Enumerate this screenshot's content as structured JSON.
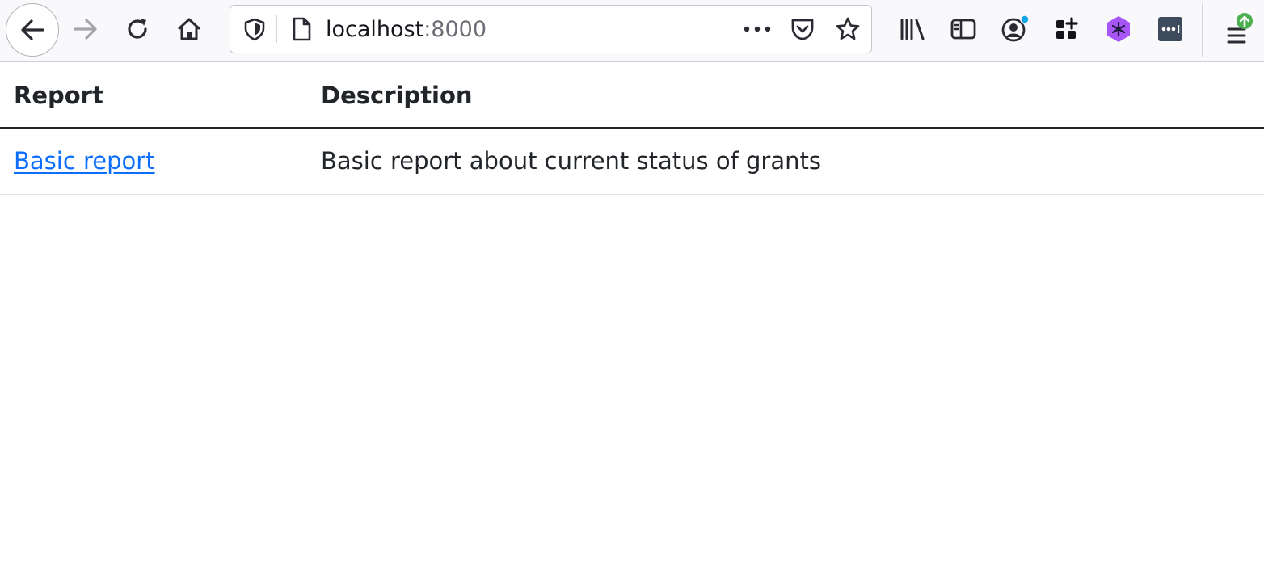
{
  "browser": {
    "url_host": "localhost",
    "url_port": ":8000",
    "toolbar_icons": [
      "back-icon",
      "forward-icon",
      "reload-icon",
      "home-icon",
      "shield-icon",
      "page-icon",
      "more-icon",
      "pocket-icon",
      "star-icon",
      "library-icon",
      "sidebar-icon",
      "account-icon",
      "extension-grid-icon",
      "extension-purple-icon",
      "extension-dark-icon",
      "menu-icon"
    ],
    "colors": {
      "notification_dot": "#0ea5e9",
      "update_badge": "#4caf50",
      "purple_extension": "#a855f7",
      "link": "#0d6efd"
    }
  },
  "table": {
    "headers": {
      "report": "Report",
      "description": "Description"
    },
    "rows": [
      {
        "report": "Basic report",
        "description": "Basic report about current status of grants"
      }
    ]
  }
}
